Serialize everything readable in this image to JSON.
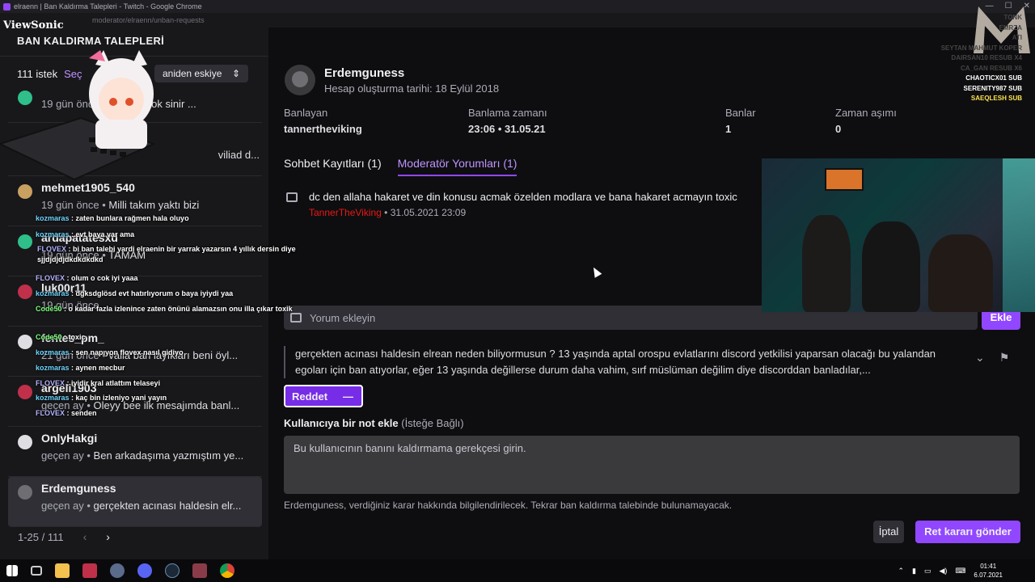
{
  "window": {
    "title": "elraenn | Ban Kaldırma Talepleri - Twitch - Google Chrome",
    "url": "moderator/elraenn/unban-requests",
    "watermark": "ViewSonic"
  },
  "sidebar": {
    "header": "BAN KALDIRMA TALEPLERİ",
    "count": "111 istek",
    "select_label": "Seç",
    "sort_label": "aniden eskiye",
    "items": [
      {
        "username": "",
        "time": "19 gün önce",
        "message": "carpsın çok sinir ..."
      },
      {
        "username": "",
        "time": "",
        "message": "viliad d..."
      },
      {
        "username": "mehmet1905_540",
        "time": "19 gün önce",
        "message": "Milli takım yaktı bizi"
      },
      {
        "username": "ardapatatesxd",
        "time": "19 gün önce",
        "message": "TAMAM"
      },
      {
        "username": "luk00r11",
        "time": "19 gün önce",
        "message": ""
      },
      {
        "username": "fentes_pm_",
        "time": "21 gün önce",
        "message": "valla ban layıkları beni öyl..."
      },
      {
        "username": "argeli1903",
        "time": "geçen ay",
        "message": "Oleyy bee ilk mesajımda banl..."
      },
      {
        "username": "OnlyHakgi",
        "time": "geçen ay",
        "message": "Ben arkadaşıma yazmıştım ye..."
      },
      {
        "username": "Erdemguness",
        "time": "geçen ay",
        "message": "gerçekten acınası haldesin elr..."
      }
    ],
    "pager": {
      "range": "1-25 / 111",
      "prev": "‹",
      "next": "›"
    }
  },
  "chat": [
    {
      "user": "kozmaras",
      "text": "zaten bunlara rağmen hala oluyo"
    },
    {
      "user": "kozmaras",
      "text": "evt baya var ama"
    },
    {
      "user": "FLOVEX",
      "text": "bi ban talebi yardi elraenin bir yarrak yazarsın 4 yıllık dersin diye sjjdjdjdjdkdkdkdkd"
    },
    {
      "user": "FLOVEX",
      "text": "olum o cok iyi yaaa"
    },
    {
      "user": "kozmaras",
      "text": "dgksdglösd evt hatırlıyorum o baya iyiydi yaa"
    },
    {
      "user": "Code50",
      "text": "o kadar fazla izlenince zaten önünü alamazsın onu illa çıkar toxik"
    },
    {
      "user": "Code50",
      "text": "toxic"
    },
    {
      "user": "kozmaras",
      "text": "sen napıyon flovex nasıl gidiyo"
    },
    {
      "user": "kozmaras",
      "text": "aynen mecbur"
    },
    {
      "user": "FLOVEX",
      "text": "iyidir kral atlattım telaseyi"
    },
    {
      "user": "kozmaras",
      "text": "kaç bin izleniyo yani yayın"
    },
    {
      "user": "FLOVEX",
      "text": "senden"
    }
  ],
  "main": {
    "username": "Erdemguness",
    "created": "Hesap oluşturma tarihi: 18 Eylül 2018",
    "fields": {
      "banned_by_label": "Banlayan",
      "banned_by": "tannertheviking",
      "ban_time_label": "Banlama zamanı",
      "ban_time": "23:06 • 31.05.21",
      "bans_label": "Banlar",
      "bans": "1",
      "timeouts_label": "Zaman aşımı",
      "timeouts": "0"
    },
    "tabs": {
      "chat_logs": "Sohbet Kayıtları (1)",
      "mod_comments": "Moderatör Yorumları (1)"
    },
    "comment": {
      "text": "dc den allaha hakaret ve din konusu acmak özelden modlara ve bana hakaret acmayın toxic",
      "author": "TannerTheViking",
      "date": "31.05.2021 23:09"
    },
    "add_comment_placeholder": "Yorum ekleyin",
    "add_button": "Ekle",
    "reason": "gerçekten acınası haldesin elrean neden biliyormusun ? 13 yaşında aptal orospu evlatlarını discord yetkilisi yaparsan olacağı bu yalandan egoları için ban atıyorlar, eğer 13 yaşında değillerse durum daha vahim, sırf müslüman değilim diye discorddan banladılar,...",
    "reject_label": "Reddet",
    "note_label": "Kullanıcıya bir not ekle",
    "note_optional": "(İsteğe Bağlı)",
    "note_placeholder": "Bu kullanıcının banını kaldırmama gerekçesi girin.",
    "note_help": "Erdemguness, verdiğiniz karar hakkında bilgilendirilecek. Tekrar ban kaldırma talebinde bulunamayacak.",
    "cancel_button": "İptal",
    "send_button": "Ret kararı gönder"
  },
  "viewers": [
    {
      "text": "TONK",
      "style": "dim"
    },
    {
      "text": "EMRZA",
      "style": "dim"
    },
    {
      "text": "ATI",
      "style": "dim"
    },
    {
      "text": "SEYTAN MAHMUT KOPER",
      "style": "dim"
    },
    {
      "text": "DAIRSAN10 RESUB X4",
      "style": "dim"
    },
    {
      "text": "CA_GAN RESUB X6",
      "style": "dim"
    },
    {
      "text": "CHAOTICX01 SUB",
      "style": "white"
    },
    {
      "text": "SERENITY987 SUB",
      "style": "white"
    },
    {
      "text": "SAEQLESH SUB",
      "style": "yellow"
    }
  ],
  "taskbar": {
    "time": "01:41",
    "date": "6.07.2021"
  },
  "colors": {
    "accent": "#9147ff",
    "accent_text": "#bf94ff",
    "mod_name": "#e91916"
  }
}
